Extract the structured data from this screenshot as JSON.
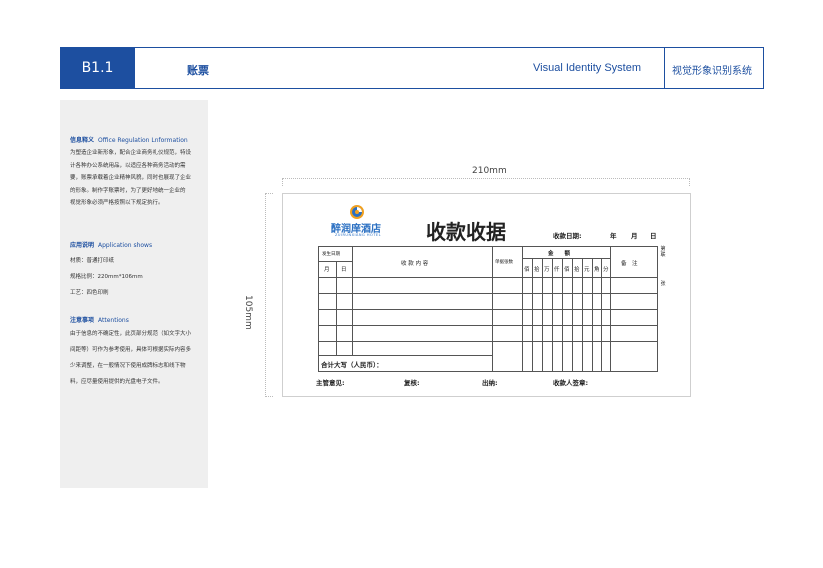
{
  "header": {
    "code": "B1.1",
    "section_title": "账票",
    "system_en": "Visual Identity System",
    "system_cn": "视觉形象识别系统"
  },
  "sidebar": {
    "info_heading_cn": "信息释义",
    "info_heading_en": "Office Regulation Lnformation",
    "info_lines": [
      "为塑造企业新形象，配合企业商务礼仪规范，特设",
      "计各种办公系统用品，以适应各种商务活动的需",
      "要，账票承载着企业精神风貌，同时也展现了企业",
      "的形象。制作字账票时，为了更好地统一企业的",
      "视觉形象必须严格按照以下规定执行。"
    ],
    "app_heading_cn": "应用说明",
    "app_heading_en": "Application shows",
    "app_lines": [
      "材质：普通打印纸",
      "规格比例：220mm*106mm",
      "工艺：四色印刷"
    ],
    "note_heading_cn": "注意事项",
    "note_heading_en": "Attentions",
    "note_lines": [
      "由于信息的不确定性，此页部分规范（如文字大小",
      "间距等）可作为参考使用，具体可根据实际内容多",
      "少来调整，在一般情况下使用成牌标志和线下物",
      "料，应尽量使用提供的光盘电子文件。"
    ]
  },
  "dimensions": {
    "width_label": "210mm",
    "height_label": "105mm"
  },
  "receipt": {
    "logo_name": "醉润庠酒店",
    "logo_en": "ZUIRUNXIANG HOTEL",
    "title": "收款收据",
    "date_label": "收款日期:",
    "year": "年",
    "month": "月",
    "day": "日",
    "side_note_top": "第联",
    "side_note_bottom": "张",
    "col_occur_date": "发生日期",
    "col_month": "月",
    "col_day": "日",
    "col_content": "收 款 内 容",
    "col_voucher": "单据张数",
    "col_amount": "金　　额",
    "col_remark": "备　注",
    "amount_units": [
      "佰",
      "拾",
      "万",
      "仟",
      "佰",
      "拾",
      "元",
      "角",
      "分"
    ],
    "total_label": "合计大写（人民币）：",
    "sig_manager": "主管意见:",
    "sig_review": "复核:",
    "sig_cashier": "出纳:",
    "sig_payee": "收款人签章:"
  }
}
